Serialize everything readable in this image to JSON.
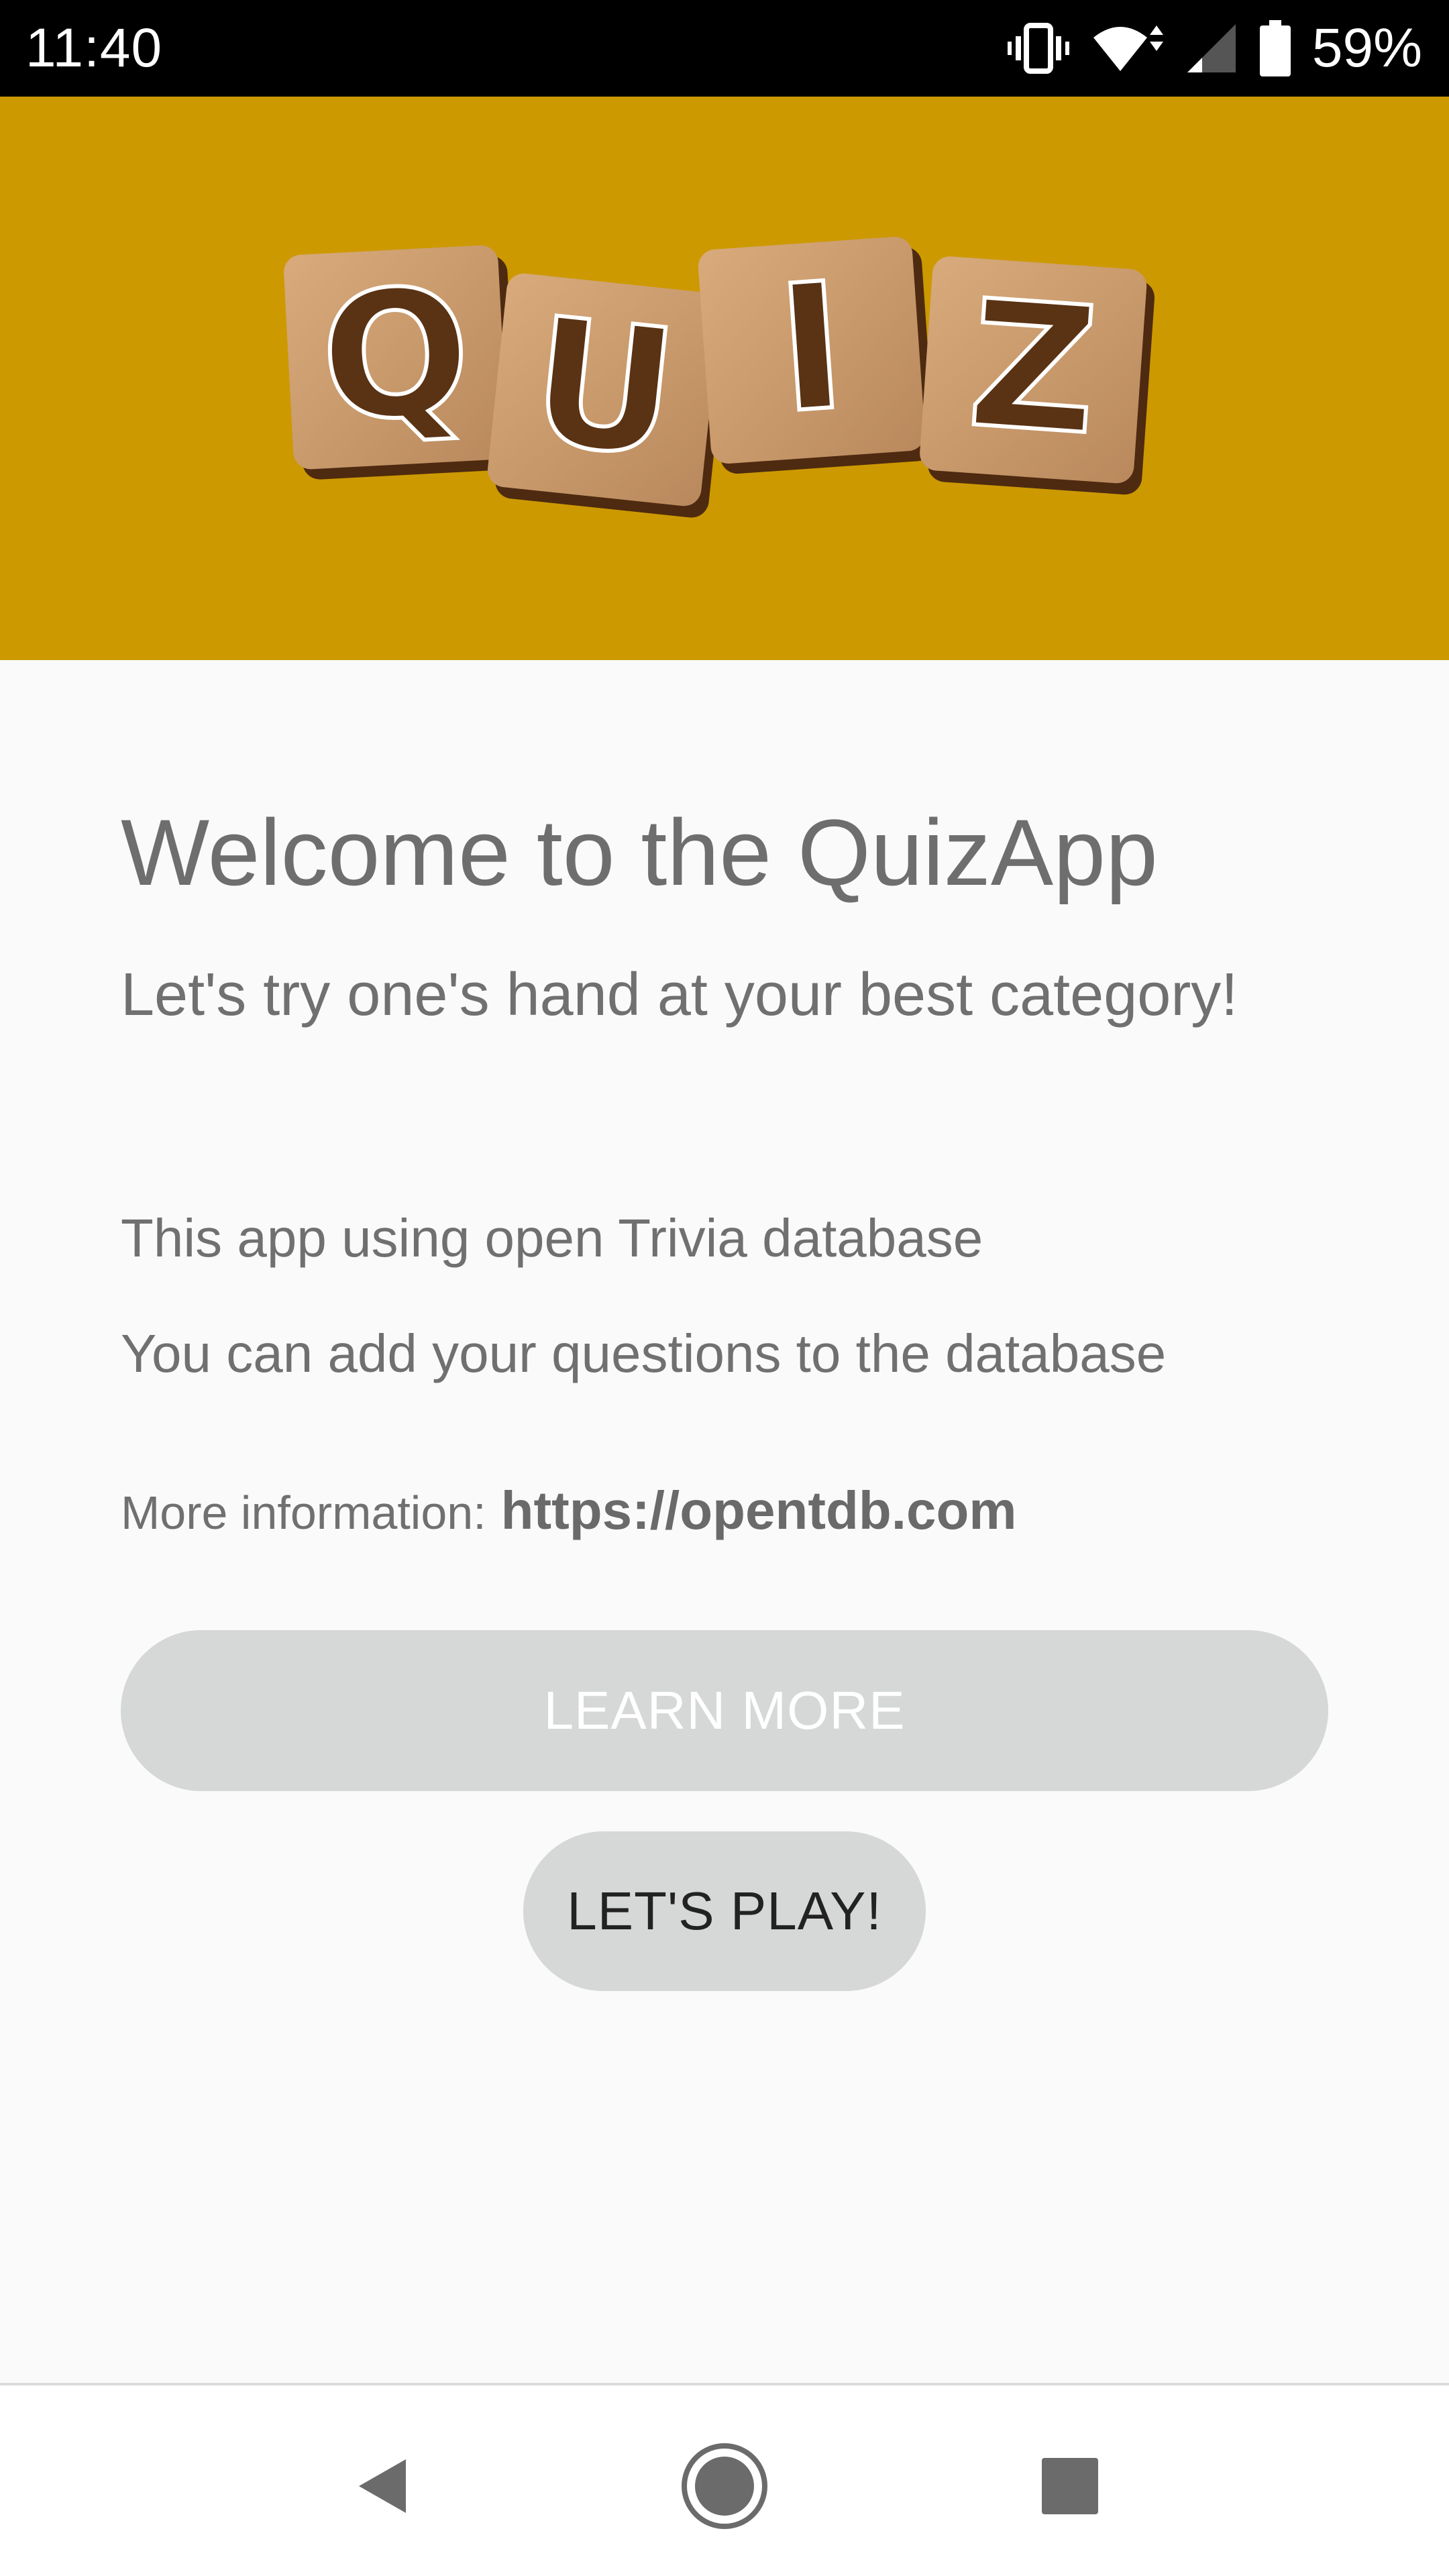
{
  "status_bar": {
    "time": "11:40",
    "battery_percent": "59%",
    "icons": [
      "vibrate-icon",
      "wifi-icon",
      "cell-signal-icon",
      "battery-icon"
    ]
  },
  "header": {
    "background_color": "#cc9900",
    "logo_letters": [
      "Q",
      "U",
      "I",
      "Z"
    ]
  },
  "main": {
    "title": "Welcome to the QuizApp",
    "subtitle": "Let's try one's hand at your best category!",
    "info_line_1": "This app using open Trivia database",
    "info_line_2": "You can add your questions to the database",
    "more_info_label": "More information:",
    "more_info_link": "https://opentdb.com"
  },
  "buttons": {
    "learn_more": "LEARN MORE",
    "play": "LET'S PLAY!"
  },
  "nav_bar": {
    "icons": [
      "back-icon",
      "home-icon",
      "recents-icon"
    ]
  }
}
